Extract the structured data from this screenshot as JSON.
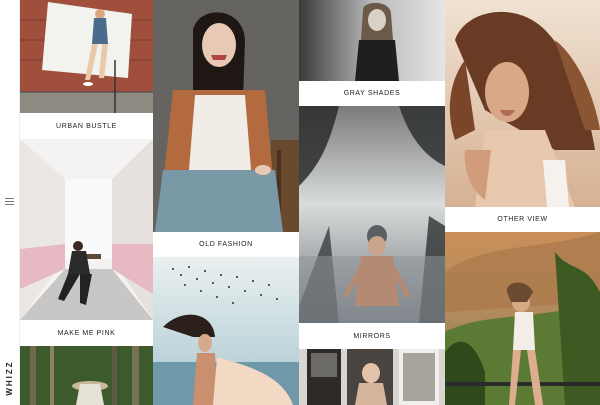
{
  "brand": {
    "name": "WHIZZ"
  },
  "menu": {
    "icon": "hamburger-menu-icon"
  },
  "gallery": {
    "urban_bustle": {
      "title": "URBAN BUSTLE"
    },
    "make_me_pink": {
      "title": "MAKE ME PINK"
    },
    "old_fashion": {
      "title": "OLD FASHION"
    },
    "gray_shades": {
      "title": "GRAY SHADES"
    },
    "mirrors": {
      "title": "MIRRORS"
    },
    "other_view": {
      "title": "OTHER VIEW"
    }
  }
}
